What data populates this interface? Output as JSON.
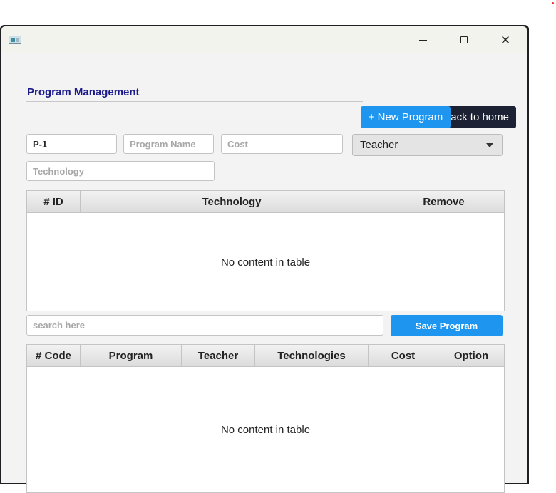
{
  "window": {
    "icon": "app-window-icon",
    "controls": {
      "minimize": "minimize-icon",
      "maximize": "maximize-icon",
      "close": "close-icon"
    }
  },
  "page": {
    "title": "Program Management"
  },
  "buttons": {
    "new_program": "+ New Program",
    "back_home": "ack to home",
    "save_program": "Save Program"
  },
  "form": {
    "program_id": "P-1",
    "program_name_placeholder": "Program Name",
    "cost_placeholder": "Cost",
    "teacher_selected": "Teacher",
    "technology_placeholder": "Technology"
  },
  "tech_table": {
    "columns": [
      "# ID",
      "Technology",
      "Remove"
    ],
    "empty_text": "No content in table"
  },
  "search": {
    "placeholder": "search here"
  },
  "program_table": {
    "columns": [
      "# Code",
      "Program",
      "Teacher",
      "Technologies",
      "Cost",
      "Option"
    ],
    "empty_text": "No content in table"
  },
  "colors": {
    "accent": "#1e96f0",
    "dark_button": "#1c2233",
    "title": "#1a1a8a"
  }
}
